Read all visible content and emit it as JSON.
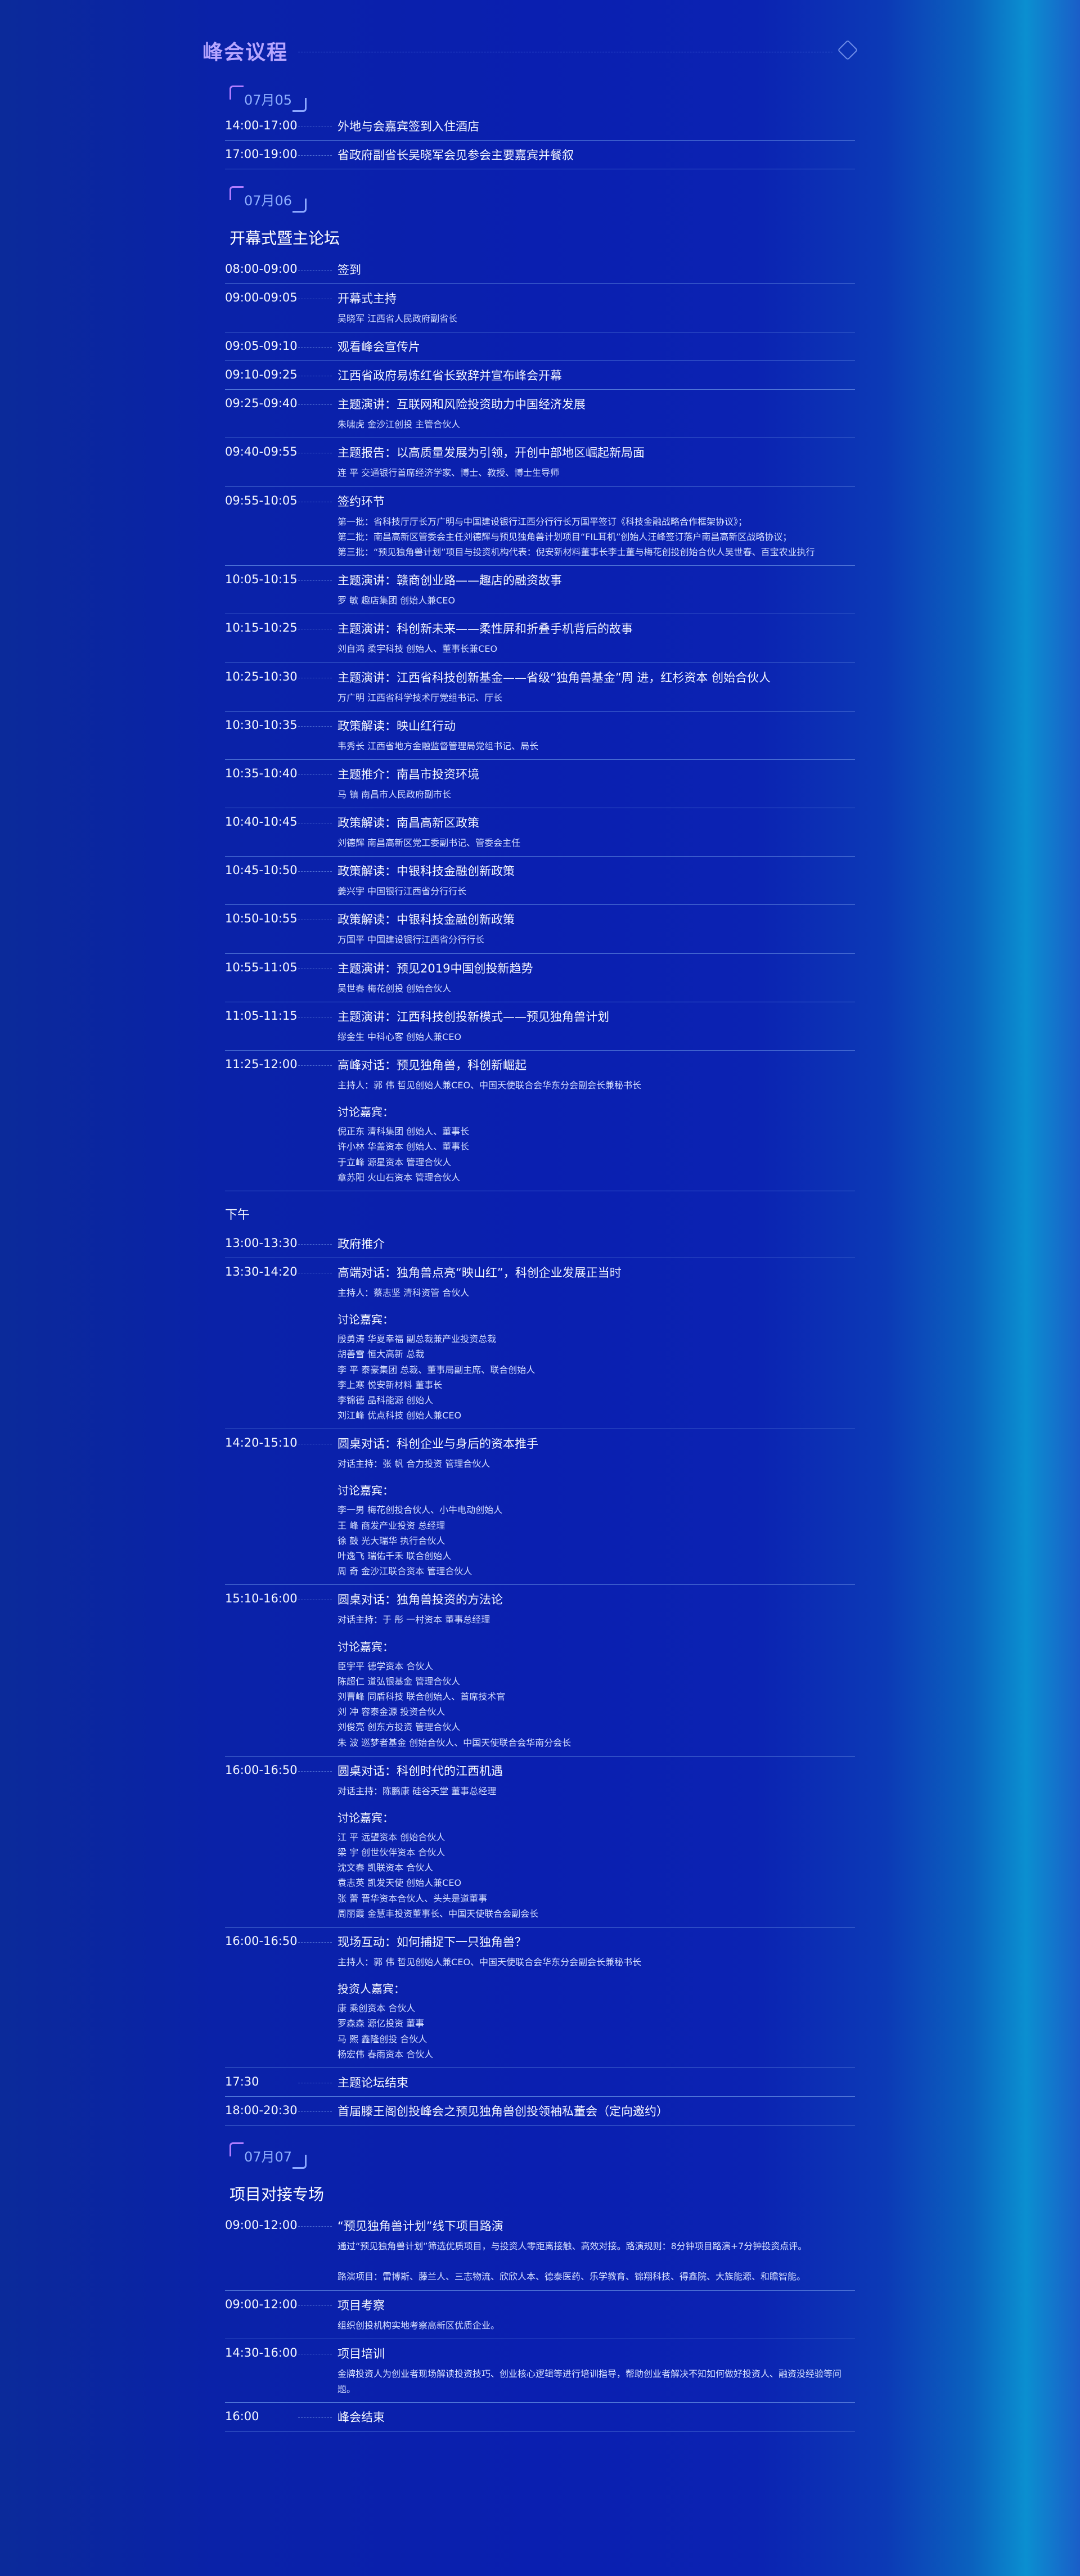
{
  "header": {
    "title": "峰会议程"
  },
  "days": [
    {
      "date": "07月05",
      "section": "",
      "rows": [
        {
          "time": "14:00-17:00",
          "title": "外地与会嘉宾签到入住酒店",
          "lines": []
        },
        {
          "time": "17:00-19:00",
          "title": "省政府副省长吴晓军会见参会主要嘉宾并餐叙",
          "lines": []
        }
      ]
    },
    {
      "date": "07月06",
      "section": "开幕式暨主论坛",
      "rows": [
        {
          "time": "08:00-09:00",
          "title": "签到",
          "lines": []
        },
        {
          "time": "09:00-09:05",
          "title": "开幕式主持",
          "lines": [
            "吴晓军  江西省人民政府副省长"
          ]
        },
        {
          "time": "09:05-09:10",
          "title": "观看峰会宣传片",
          "lines": []
        },
        {
          "time": "09:10-09:25",
          "title": "江西省政府易炼红省长致辞并宣布峰会开幕",
          "lines": []
        },
        {
          "time": "09:25-09:40",
          "title": "主题演讲：互联网和风险投资助力中国经济发展",
          "lines": [
            "朱啸虎  金沙江创投 主管合伙人"
          ]
        },
        {
          "time": "09:40-09:55",
          "title": "主题报告：以高质量发展为引领，开创中部地区崛起新局面",
          "lines": [
            "连  平  交通银行首席经济学家、博士、教授、博士生导师"
          ]
        },
        {
          "time": "09:55-10:05",
          "title": "签约环节",
          "lines": [
            "第一批：省科技厅厅长万广明与中国建设银行江西分行行长万国平签订《科技金融战略合作框架协议》；",
            "第二批：南昌高新区管委会主任刘德辉与预见独角兽计划项目“FIL耳机”创始人汪峰签订落户南昌高新区战略协议；",
            "第三批：“预见独角兽计划”项目与投资机构代表：倪安新材料董事长李士董与梅花创投创始合伙人吴世春、百宝农业执行"
          ]
        },
        {
          "time": "10:05-10:15",
          "title": "主题演讲：赣商创业路——趣店的融资故事",
          "lines": [
            "罗  敏  趣店集团 创始人兼CEO"
          ]
        },
        {
          "time": "10:15-10:25",
          "title": "主题演讲：科创新未来——柔性屏和折叠手机背后的故事",
          "lines": [
            "刘自鸿  柔宇科技 创始人、董事长兼CEO"
          ]
        },
        {
          "time": "10:25-10:30",
          "title": "主题演讲：江西省科技创新基金——省级“独角兽基金”周  进，红杉资本 创始合伙人",
          "lines": [
            "万广明  江西省科学技术厅党组书记、厅长"
          ]
        },
        {
          "time": "10:30-10:35",
          "title": "政策解读：映山红行动",
          "lines": [
            "韦秀长  江西省地方金融监督管理局党组书记、局长"
          ]
        },
        {
          "time": "10:35-10:40",
          "title": "主题推介：南昌市投资环境",
          "lines": [
            "马  镇  南昌市人民政府副市长"
          ]
        },
        {
          "time": "10:40-10:45",
          "title": "政策解读：南昌高新区政策",
          "lines": [
            "刘德辉  南昌高新区党工委副书记、管委会主任"
          ]
        },
        {
          "time": "10:45-10:50",
          "title": "政策解读：中银科技金融创新政策",
          "lines": [
            "姜兴宇  中国银行江西省分行行长"
          ]
        },
        {
          "time": "10:50-10:55",
          "title": "政策解读：中银科技金融创新政策",
          "lines": [
            "万国平  中国建设银行江西省分行行长"
          ]
        },
        {
          "time": "10:55-11:05",
          "title": "主题演讲：预见2019中国创投新趋势",
          "lines": [
            "吴世春  梅花创投 创始合伙人"
          ]
        },
        {
          "time": "11:05-11:15",
          "title": "主题演讲：江西科技创投新模式——预见独角兽计划",
          "lines": [
            "缪金生  中科心客 创始人兼CEO"
          ]
        },
        {
          "time": "11:25-12:00",
          "title": "高峰对话：预见独角兽，科创新崛起",
          "lines": [
            "主持人：郭  伟  哲见创始人兼CEO、中国天使联合会华东分会副会长兼秘书长"
          ],
          "label": "讨论嘉宾：",
          "guests": [
            "倪正东  清科集团 创始人、董事长",
            "许小林  华盖资本 创始人、董事长",
            "于立峰  源星资本 管理合伙人",
            "章苏阳  火山石资本 管理合伙人"
          ]
        }
      ],
      "part": "下午",
      "rows2": [
        {
          "time": "13:00-13:30",
          "title": "政府推介",
          "lines": []
        },
        {
          "time": "13:30-14:20",
          "title": "高端对话：独角兽点亮“映山红”，科创企业发展正当时",
          "lines": [
            "主持人：蔡志坚  清科资管 合伙人"
          ],
          "label": "讨论嘉宾：",
          "guests": [
            "殷勇涛  华夏幸福 副总裁兼产业投资总裁",
            "胡善雪  恒大高新 总裁",
            "李  平  泰豪集团 总裁、董事局副主席、联合创始人",
            "李上寒  悦安新材料 董事长",
            "李锦德  晶科能源 创始人",
            "刘江峰  优点科技 创始人兼CEO"
          ]
        },
        {
          "time": "14:20-15:10",
          "title": "圆桌对话：科创企业与身后的资本推手",
          "lines": [
            "对话主持：张  帆  合力投资 管理合伙人"
          ],
          "label": "讨论嘉宾：",
          "guests": [
            "李一男  梅花创投合伙人、小牛电动创始人",
            "王  峰  商发产业投资 总经理",
            "徐  鼓  光大瑞华 执行合伙人",
            "叶逸飞  瑞佑千禾 联合创始人",
            "周  奇  金沙江联合资本 管理合伙人"
          ]
        },
        {
          "time": "15:10-16:00",
          "title": "圆桌对话：独角兽投资的方法论",
          "lines": [
            "对话主持：于  彤  一村资本 董事总经理"
          ],
          "label": "讨论嘉宾：",
          "guests": [
            "臣宇平  德学资本 合伙人",
            "陈超仁  道弘银基金 管理合伙人",
            "刘曹峰  同盾科技 联合创始人、首席技术官",
            "刘  冲  容泰金源 投资合伙人",
            "刘俊亮  创东方投资 管理合伙人",
            "朱  波  巡梦者基金 创始合伙人、中国天使联合会华南分会长"
          ]
        },
        {
          "time": "16:00-16:50",
          "title": "圆桌对话：科创时代的江西机遇",
          "lines": [
            "对话主持：陈鹏康  硅谷天堂 董事总经理"
          ],
          "label": "讨论嘉宾：",
          "guests": [
            "江  平  远望资本 创始合伙人",
            "梁  宇  创世伙伴资本 合伙人",
            "沈文春  凯联资本 合伙人",
            "袁志英  凯发天使 创始人兼CEO",
            "张  蕾  晋华资本合伙人、头头是道董事",
            "周丽霞  金慧丰投资董事长、中国天使联合会副会长"
          ]
        },
        {
          "time": "16:00-16:50",
          "title": "现场互动：如何捕捉下一只独角兽？",
          "lines": [
            "主持人：郭  伟  哲见创始人兼CEO、中国天使联合会华东分会副会长兼秘书长"
          ],
          "label": "投资人嘉宾：",
          "guests": [
            "康  乘创资本 合伙人",
            "罗森森  源亿投资 董事",
            "马  熙  鑫隆创投 合伙人",
            "杨宏伟  春雨资本 合伙人"
          ]
        },
        {
          "time": "17:30",
          "title": "主题论坛结束",
          "lines": []
        },
        {
          "time": "18:00-20:30",
          "title": "首届滕王阁创投峰会之预见独角兽创投领袖私董会（定向邀约）",
          "lines": []
        }
      ]
    },
    {
      "date": "07月07",
      "section": "项目对接专场",
      "rows": [
        {
          "time": "09:00-12:00",
          "title": "“预见独角兽计划”线下项目路演",
          "lines": [
            "通过“预见独角兽计划”筛选优质项目，与投资人零距离接触、高效对接。路演规则：8分钟项目路演+7分钟投资点评。",
            "",
            "路演项目：雷博斯、藤兰人、三志物流、欣欣人本、德泰医药、乐学教育、锦翔科技、得鑫院、大族能源、和瞻智能。"
          ]
        },
        {
          "time": "09:00-12:00",
          "title": "项目考察",
          "lines": [
            "组织创投机构实地考察高新区优质企业。"
          ]
        },
        {
          "time": "14:30-16:00",
          "title": "项目培训",
          "lines": [
            "金牌投资人为创业者现场解读投资技巧、创业核心逻辑等进行培训指导，帮助创业者解决不知如何做好投资人、融资没经验等问题。"
          ]
        },
        {
          "time": "16:00",
          "title": "峰会结束",
          "lines": []
        }
      ]
    }
  ]
}
